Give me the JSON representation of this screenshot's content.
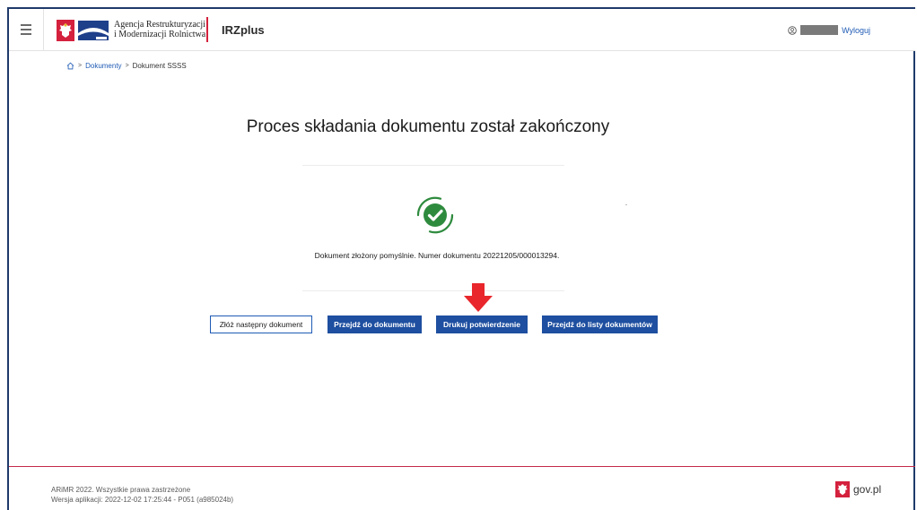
{
  "header": {
    "agency_line1": "Agencja Restrukturyzacji",
    "agency_line2": "i Modernizacji Rolnictwa",
    "app_name": "IRZplus",
    "logout_label": "Wyloguj",
    "menu_icon": "hamburger-icon",
    "user_icon": "user-icon"
  },
  "breadcrumb": {
    "home_icon": "home-icon",
    "items": [
      "Dokumenty",
      "Dokument SSSS"
    ],
    "separator": ">"
  },
  "main": {
    "title": "Proces składania dokumentu został zakończony",
    "status_icon": "success-check-icon",
    "message": "Dokument złożony pomyślnie. Numer dokumentu 20221205/000013294.",
    "buttons": [
      "Złóż następny dokument",
      "Przejdź do dokumentu",
      "Drukuj potwierdzenie",
      "Przejdź do listy dokumentów"
    ]
  },
  "footer": {
    "copyright": "ARiMR 2022. Wszystkie prawa zastrzeżone",
    "version": "Wersja aplikacji: 2022-12-02 17:25:44 - P051 (a985024b)",
    "gov_label": "gov.pl"
  },
  "colors": {
    "primary": "#1e4fa0",
    "accent_red": "#d4213d",
    "success_green": "#2e8b3e"
  }
}
